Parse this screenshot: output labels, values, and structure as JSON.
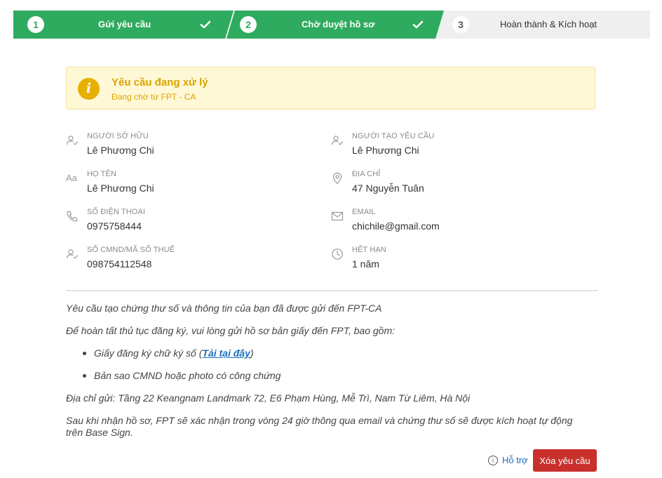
{
  "stepper": {
    "steps": [
      {
        "number": "1",
        "label": "Gửi yêu cầu"
      },
      {
        "number": "2",
        "label": "Chờ duyệt hồ sơ"
      },
      {
        "number": "3",
        "label": "Hoàn thành & Kích hoạt"
      }
    ]
  },
  "alert": {
    "title": "Yêu cầu đang xử lý",
    "subtitle": "Đang chờ từ FPT - CA"
  },
  "info": {
    "owner": {
      "label": "Người sở hữu",
      "value": "Lê Phương Chi"
    },
    "fullname": {
      "label": "Họ tên",
      "value": "Lê Phương Chi"
    },
    "phone": {
      "label": "Số điện thoại",
      "value": "0975758444"
    },
    "idnumber": {
      "label": "Số CMND/Mã số thuế",
      "value": "098754112548"
    },
    "requester": {
      "label": "Người tạo yêu cầu",
      "value": "Lê Phương Chi"
    },
    "address": {
      "label": "Địa chỉ",
      "value": "47 Nguyễn Tuân"
    },
    "email": {
      "label": "Email",
      "value": "chichile@gmail.com"
    },
    "expiry": {
      "label": "Hết hạn",
      "value": "1 năm"
    }
  },
  "instructions": {
    "line1": "Yêu cầu tạo chứng thư số và thông tin của bạn đã được gửi đến FPT-CA",
    "line2": "Để hoàn tất thủ tục đăng ký, vui lòng gửi hồ sơ bản giấy đến FPT, bao gồm:",
    "bullet1_prefix": "Giấy đăng ký chữ ký số (",
    "bullet1_link": "Tải tại đây",
    "bullet1_suffix": ")",
    "bullet2": "Bản sao CMND hoặc photo có công chứng",
    "address_line": "Địa chỉ gửi: Tầng 22 Keangnam Landmark 72, E6 Phạm Hùng, Mễ Trì, Nam Từ Liêm, Hà Nội",
    "final": "Sau khi nhận hồ sơ, FPT sẽ xác nhận trong vòng 24 giờ thông qua email và chứng thư số sẽ được kích hoạt tự động trên Base Sign."
  },
  "actions": {
    "help_label": "Hỗ trợ",
    "delete_label": "Xóa yêu cầu"
  },
  "colors": {
    "step_active": "#2eab5e",
    "alert_text": "#d9a400",
    "delete_button": "#c9302c",
    "link": "#1a6fc0"
  }
}
